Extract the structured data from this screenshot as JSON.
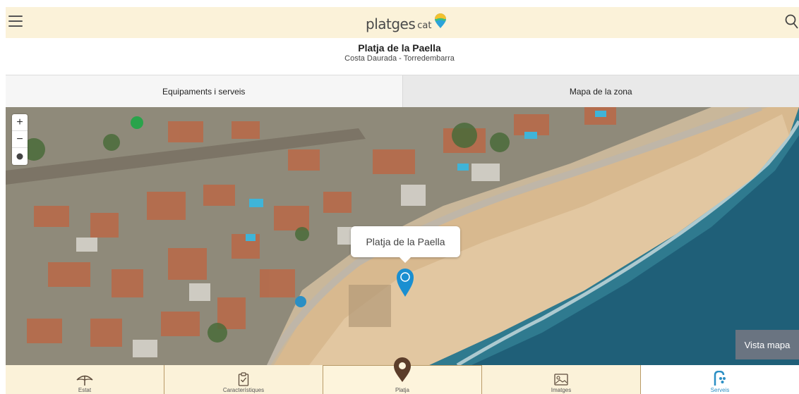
{
  "header": {
    "logo_main": "platges",
    "logo_sub": "cat",
    "menu_icon": "hamburger-menu-icon",
    "search_icon": "search-icon"
  },
  "beach": {
    "title": "Platja de la Paella",
    "subtitle": "Costa Daurada - Torredembarra"
  },
  "tabs": [
    {
      "label": "Equipaments i serveis",
      "active": true
    },
    {
      "label": "Mapa de la zona",
      "active": false
    }
  ],
  "map": {
    "zoom_in": "+",
    "zoom_out": "−",
    "popup_label": "Platja de la Paella",
    "vista_button": "Vista mapa",
    "pin_color": "#1a8fd1"
  },
  "bottom_nav": [
    {
      "label": "Estat",
      "icon": "umbrella-icon"
    },
    {
      "label": "Característiques",
      "icon": "clipboard-icon"
    },
    {
      "label": "Platja",
      "icon": "map-pin-icon",
      "active": true
    },
    {
      "label": "Imatges",
      "icon": "image-icon"
    },
    {
      "label": "Serveis",
      "icon": "services-icon"
    }
  ],
  "colors": {
    "header_bg": "#fbf2d9",
    "accent_blue": "#2b8fc4",
    "pin_brown": "#5b3d2a"
  }
}
